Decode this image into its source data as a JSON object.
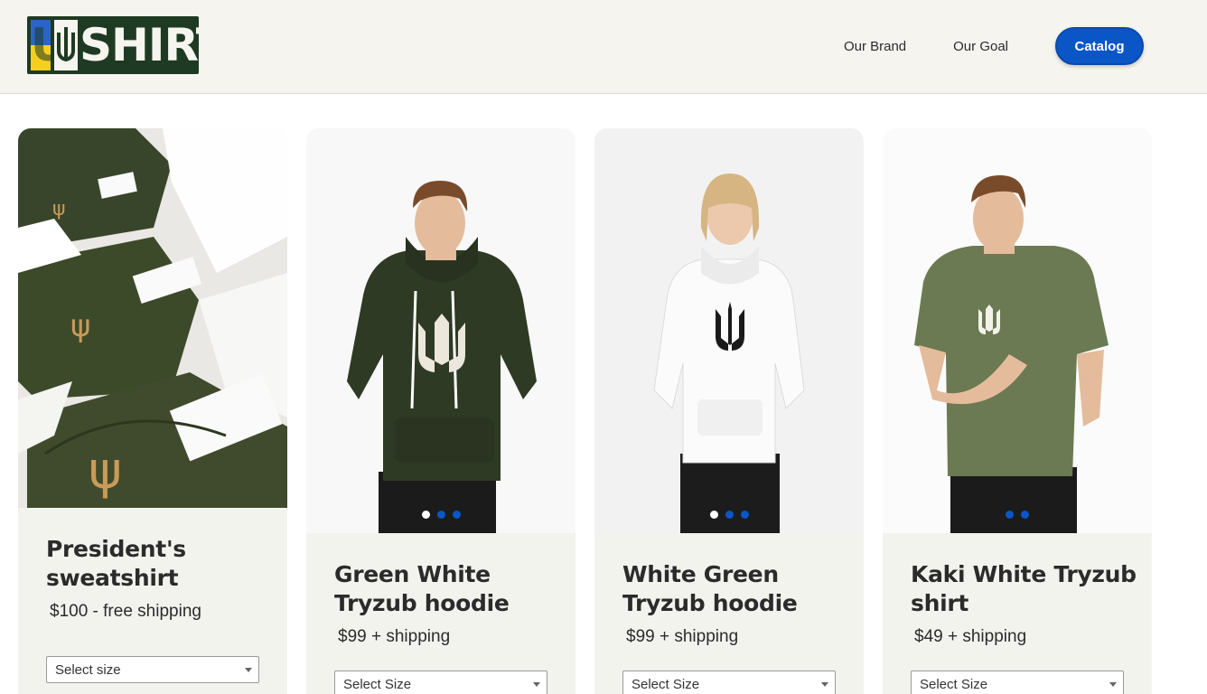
{
  "header": {
    "logo_text": "SHIRT",
    "logo_letter": "U",
    "nav": {
      "brand": "Our Brand",
      "goal": "Our Goal",
      "catalog": "Catalog"
    }
  },
  "colors": {
    "accent": "#0b56c7",
    "header_bg": "#f5f4ef",
    "card_bg": "#f3f3ee",
    "logo_green": "#1f3a22",
    "flag_blue": "#2b64c6",
    "flag_yellow": "#f4cf1f"
  },
  "products": [
    {
      "title": "President's sweatshirt",
      "price": "$100 - free shipping",
      "select_label": "Select size",
      "image_icon": "olive-sweatshirts-photo",
      "carousel": null
    },
    {
      "title": "Green White Tryzub hoodie",
      "price": "$99 + shipping",
      "select_label": "Select Size",
      "image_icon": "green-hoodie-model-photo",
      "carousel": {
        "count": 3,
        "active": 0
      }
    },
    {
      "title": "White Green Tryzub hoodie",
      "price": "$99 + shipping",
      "select_label": "Select Size",
      "image_icon": "white-hoodie-model-photo",
      "carousel": {
        "count": 3,
        "active": 0
      }
    },
    {
      "title": "Kaki White Tryzub shirt",
      "price": "$49 + shipping",
      "select_label": "Select Size",
      "image_icon": "kaki-shirt-model-photo",
      "carousel": {
        "count": 2,
        "active": -1
      }
    }
  ]
}
